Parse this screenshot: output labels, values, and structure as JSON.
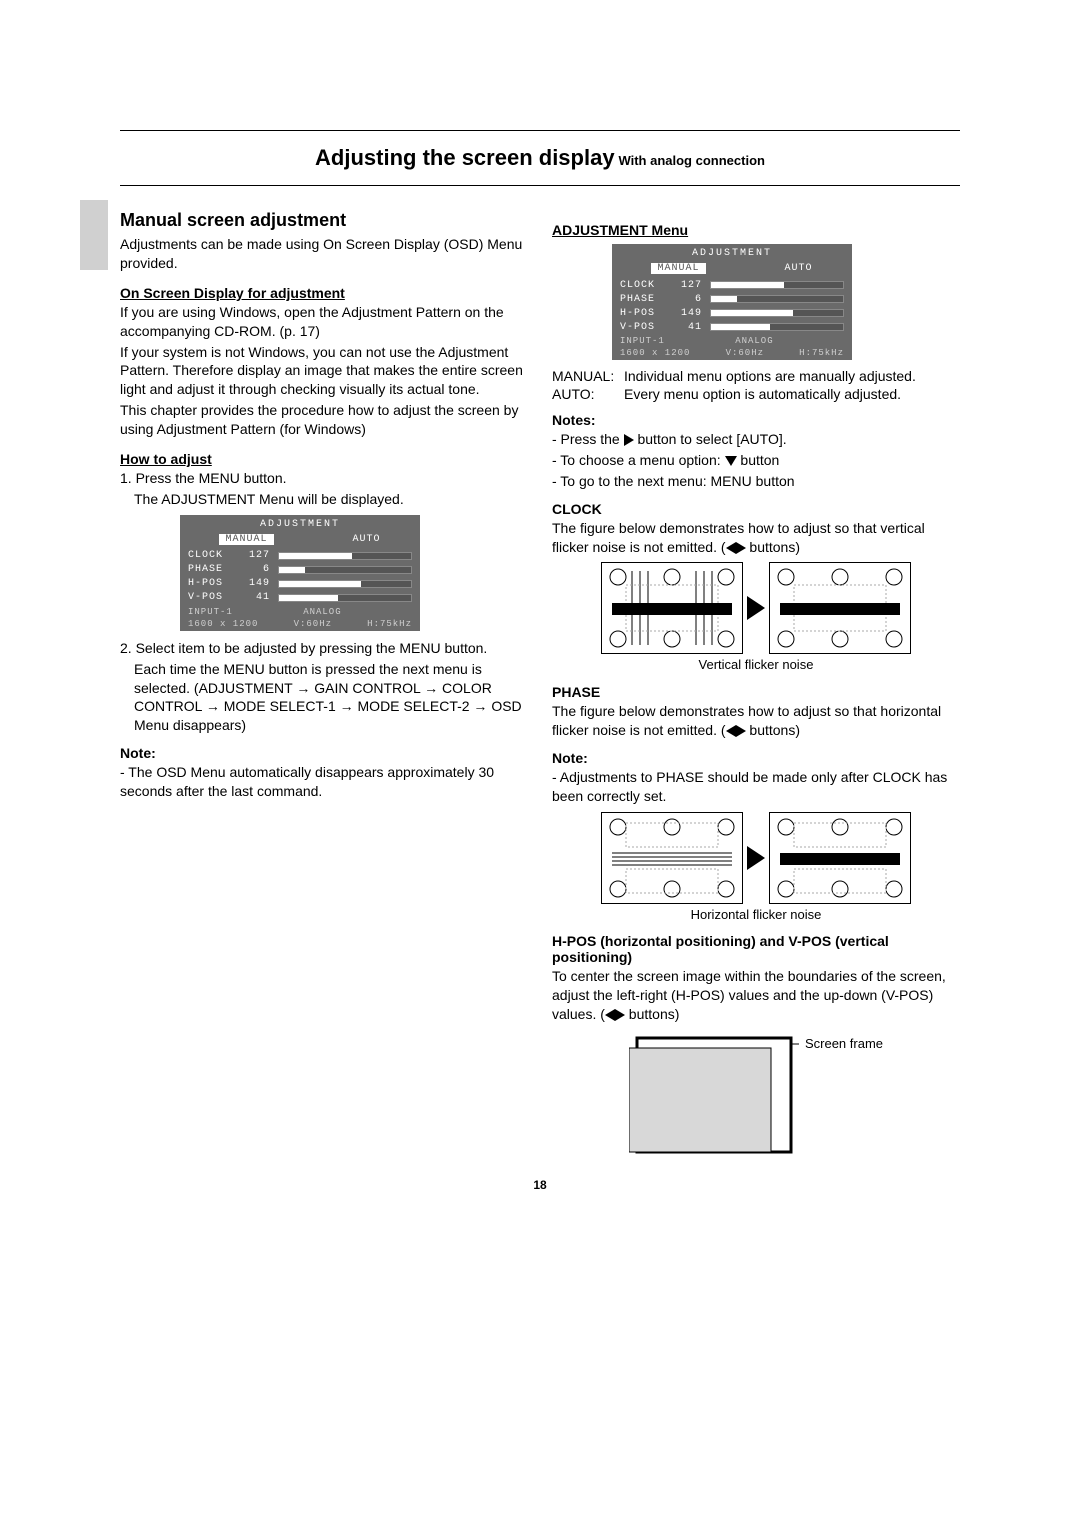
{
  "title": {
    "main": "Adjusting the screen display",
    "sub": "With analog connection"
  },
  "pageNumber": "18",
  "left": {
    "h2": "Manual screen adjustment",
    "intro": "Adjustments can be made using On Screen Display (OSD) Menu provided.",
    "osdHeading": "On Screen Display for adjustment",
    "osdP1": "If you are using Windows, open the Adjustment Pattern on the accompanying CD-ROM. (p. 17)",
    "osdP2": "If your system is not Windows, you can not use the Adjustment Pattern. Therefore display an image that makes the entire screen light and adjust it through checking visually its actual tone.",
    "osdP3": "This chapter provides the procedure how to adjust the screen by using Adjustment Pattern (for Windows)",
    "howHeading": "How to adjust",
    "step1a": "1. Press the MENU button.",
    "step1b": "The ADJUSTMENT Menu will be displayed.",
    "step2a": "2. Select item to be adjusted by pressing the MENU button.",
    "step2b": "Each time the MENU button is pressed the next menu is selected. (ADJUSTMENT → GAIN CONTROL → COLOR CONTROL → MODE SELECT-1 → MODE SELECT-2 → OSD Menu disappears)",
    "noteHeading": "Note:",
    "note1": "- The OSD Menu automatically disappears approximately 30 seconds after the last command."
  },
  "right": {
    "menuHeading": "ADJUSTMENT Menu",
    "manual": {
      "term": "MANUAL:",
      "def": "Individual menu options are manually adjusted."
    },
    "auto": {
      "term": "AUTO:",
      "def": "Every menu option is automatically adjusted."
    },
    "notesHeading": "Notes:",
    "noteA_pre": "- Press the ",
    "noteA_post": " button to select [AUTO].",
    "noteB_pre": "- To choose a menu option: ",
    "noteB_post": " button",
    "noteC": "- To go to the next menu: MENU button",
    "clockHeading": "CLOCK",
    "clockText_pre": "The figure below demonstrates how to adjust so that vertical flicker noise is not emitted. (",
    "clockText_post": " buttons)",
    "clockCaption": "Vertical flicker noise",
    "phaseHeading": "PHASE",
    "phaseText_pre": "The figure below demonstrates how to adjust so that horizontal flicker noise is not emitted. (",
    "phaseText_post": " buttons)",
    "phaseNoteHeading": "Note:",
    "phaseNote": "- Adjustments to PHASE should be made only after CLOCK has been correctly set.",
    "phaseCaption": "Horizontal flicker noise",
    "hvHeading": "H-POS (horizontal positioning) and V-POS (vertical positioning)",
    "hvText_pre": "To center the screen image within the boundaries of the screen, adjust the left-right (H-POS) values and the up-down (V-POS) values. (",
    "hvText_post": " buttons)",
    "frameLabel": "Screen frame"
  },
  "osd": {
    "title": "ADJUSTMENT",
    "modeSel": "MANUAL",
    "modeOther": "AUTO",
    "rows": [
      {
        "label": "CLOCK",
        "value": "127",
        "pct": 55
      },
      {
        "label": "PHASE",
        "value": "6",
        "pct": 20
      },
      {
        "label": "H-POS",
        "value": "149",
        "pct": 62
      },
      {
        "label": "V-POS",
        "value": "41",
        "pct": 45
      }
    ],
    "ft1a": "INPUT-1",
    "ft1b": "ANALOG",
    "ft2a": "1600 x 1200",
    "ft2b": "V:60Hz",
    "ft2c": "H:75kHz"
  }
}
